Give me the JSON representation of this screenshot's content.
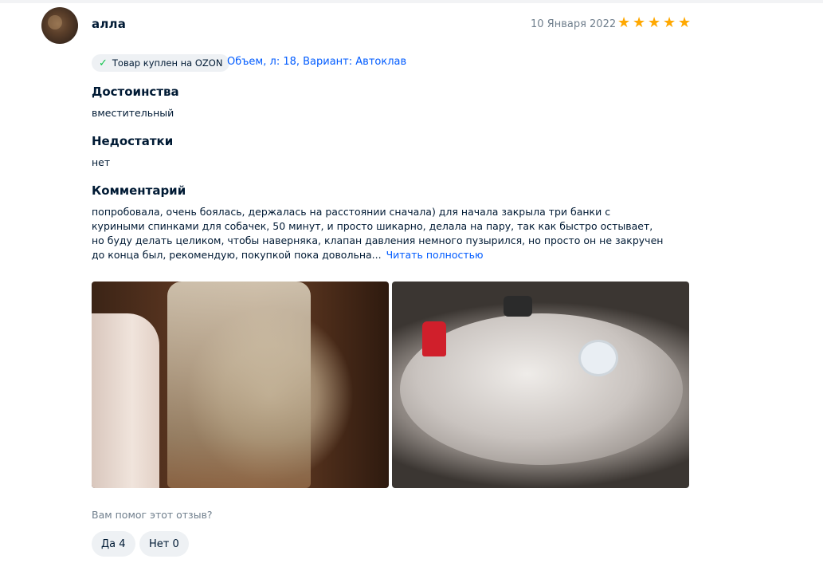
{
  "review": {
    "author": "алла",
    "date": "10 Января 2022",
    "rating": 5,
    "purchase_badge": "Товар куплен на OZON",
    "variant": "Объем, л: 18, Вариант: Автоклав",
    "pros_title": "Достоинства",
    "pros_text": "вместительный",
    "cons_title": "Недостатки",
    "cons_text": "нет",
    "comment_title": "Комментарий",
    "comment_text": "попробовала, очень боялась, держалась на расстоянии сначала) для начала закрыла три банки с куриными спинками для собачек, 50 минут, и просто шикарно, делала на пару, так как быстро остывает, но буду делать целиком, чтобы наверняка, клапан давления немного пузырился, но просто он не закручен до конца был, рекомендую, покупкой пока довольна...",
    "read_more": "Читать полностью",
    "helpful_question": "Вам помог этот отзыв?",
    "yes_button": "Да 4",
    "no_button": "Нет 0"
  },
  "colors": {
    "star": "#ffa800",
    "link": "#005bff",
    "check": "#10c44c",
    "muted": "#707f8d"
  },
  "icons": {
    "star": "star-icon",
    "check": "check-icon"
  }
}
